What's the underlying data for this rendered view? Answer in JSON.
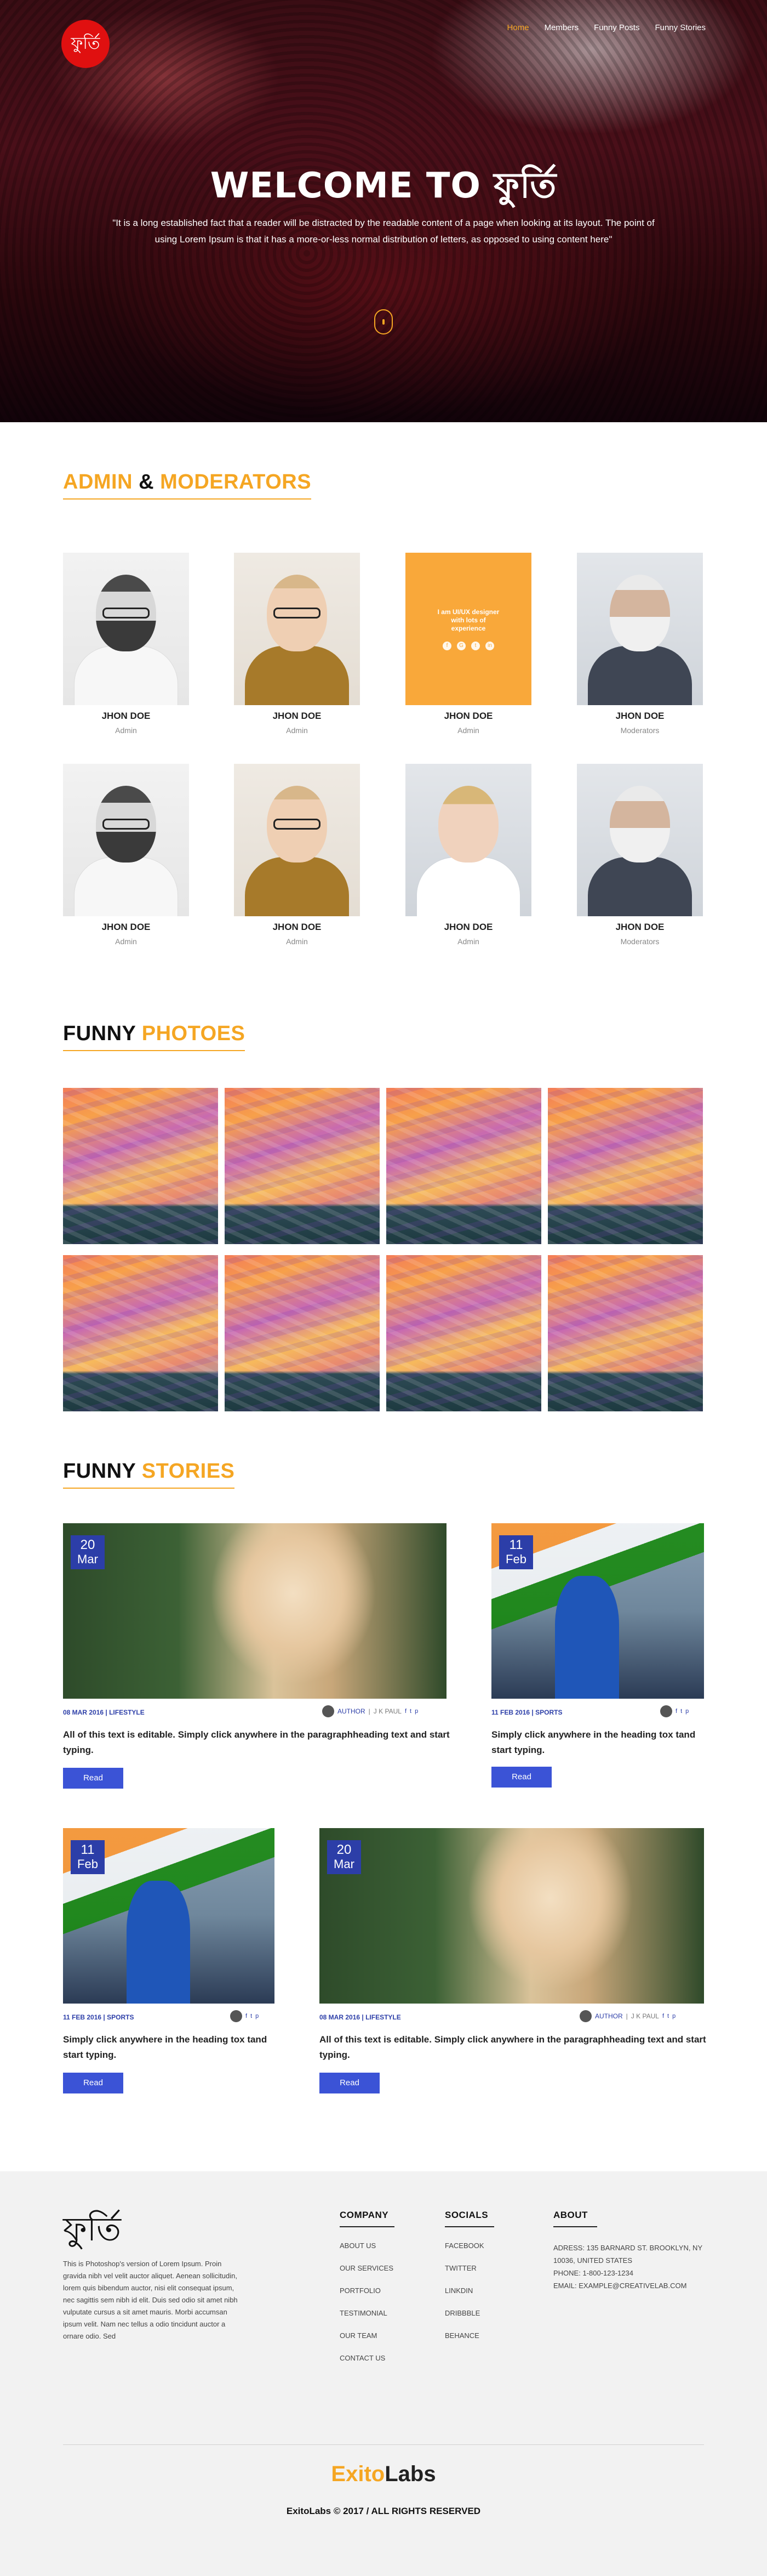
{
  "header": {
    "logo_glyph": "ফুর্তি",
    "nav": [
      "Home",
      "Members",
      "Funny Posts",
      "Funny Stories"
    ],
    "active_nav": "Home"
  },
  "hero": {
    "title": "WELCOME TO ফুর্তি",
    "text": "\"It is a long established fact that a reader will be distracted by the readable content of a page when looking at its layout. The point of using Lorem Ipsum is that it has a more-or-less normal distribution of letters, as opposed to using content here\""
  },
  "admins": {
    "title_a": "ADMIN",
    "title_amp": " & ",
    "title_b": "MODERATORS",
    "members": [
      {
        "name": "JHON DOE",
        "role": "Admin"
      },
      {
        "name": "JHON DOE",
        "role": "Admin"
      },
      {
        "name": "JHON DOE",
        "role": "Admin",
        "hover_text": "I am UI/UX designer with lots of experience"
      },
      {
        "name": "JHON DOE",
        "role": "Moderators"
      },
      {
        "name": "JHON DOE",
        "role": "Admin"
      },
      {
        "name": "JHON DOE",
        "role": "Admin"
      },
      {
        "name": "JHON DOE",
        "role": "Admin"
      },
      {
        "name": "JHON DOE",
        "role": "Moderators"
      }
    ]
  },
  "photos": {
    "title_a": "FUNNY ",
    "title_b": "PHOTOES"
  },
  "stories": {
    "title_a": "FUNNY ",
    "title_b": "STORIES",
    "items": [
      {
        "day": "20",
        "month": "Mar",
        "meta_date": "08 MAR 2016",
        "meta_cat": "LIFESTYLE",
        "author_label": "AUTHOR",
        "author_name": "J K PAUL",
        "title": "All of this text is editable. Simply click anywhere in the paragraphheading text and start typing.",
        "button": "Read"
      },
      {
        "day": "11",
        "month": "Feb",
        "meta_date": "11 FEB 2016",
        "meta_cat": "SPORTS",
        "title": "Simply click anywhere in the heading tox tand start typing.",
        "button": "Read"
      },
      {
        "day": "11",
        "month": "Feb",
        "meta_date": "11 FEB 2016",
        "meta_cat": "SPORTS",
        "title": "Simply click anywhere in the heading tox tand start typing.",
        "button": "Read"
      },
      {
        "day": "20",
        "month": "Mar",
        "meta_date": "08 MAR 2016",
        "meta_cat": "LIFESTYLE",
        "author_label": "AUTHOR",
        "author_name": "J K PAUL",
        "title": "All of this text is editable. Simply click anywhere in the paragraphheading text and start typing.",
        "button": "Read"
      }
    ]
  },
  "footer": {
    "logo_glyph": "ফুর্তি",
    "about": "This is Photoshop's version of Lorem Ipsum. Proin gravida nibh vel velit auctor aliquet. Aenean sollicitudin, lorem quis bibendum auctor, nisi elit consequat ipsum, nec sagittis sem nibh id elit. Duis sed odio sit amet nibh vulputate cursus a sit amet mauris. Morbi accumsan ipsum velit. Nam nec tellus a odio tincidunt auctor a ornare odio. Sed",
    "company_title": "COMPANY",
    "company_links": [
      "ABOUT US",
      "OUR SERVICES",
      "PORTFOLIO",
      "TESTIMONIAL",
      "OUR TEAM",
      "CONTACT US"
    ],
    "socials_title": "SOCIALS",
    "social_links": [
      "FACEBOOK",
      "TWITTER",
      "LINKDIN",
      "DRIBBBLE",
      "BEHANCE"
    ],
    "about_title": "ABOUT",
    "address": "ADRESS: 135 BARNARD ST. BROOKLYN, NY 10036, UNITED STATES",
    "phone": "PHONE: 1-800-123-1234",
    "email": "EMAIL: EXAMPLE@CREATIVELAB.COM",
    "brand_a": "Exito",
    "brand_b": "Labs",
    "copyright": "ExitoLabs © 2017  / ALL RIGHTS RESERVED"
  }
}
